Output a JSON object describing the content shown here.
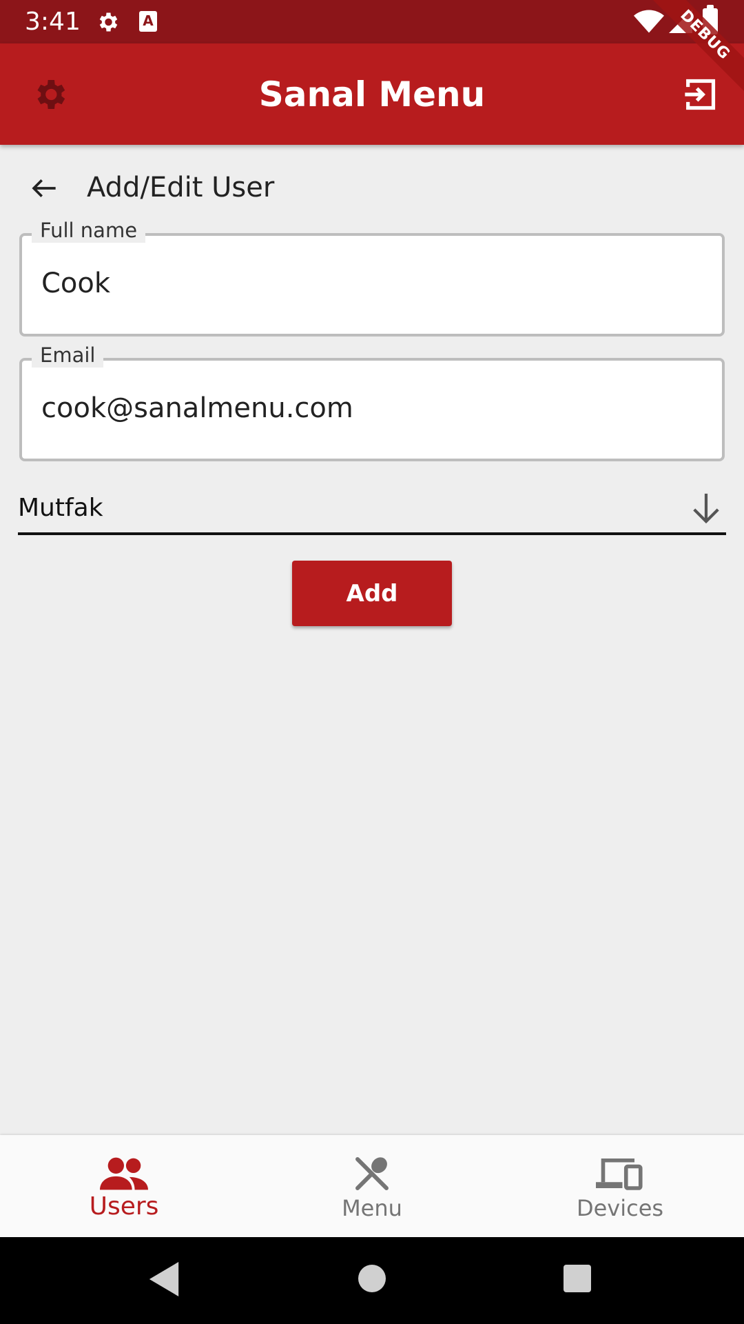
{
  "status_bar": {
    "time": "3:41",
    "icons": [
      "gear-icon",
      "a-badge-icon",
      "wifi-icon",
      "signal-icon",
      "battery-icon"
    ]
  },
  "debug_banner": "DEBUG",
  "app_bar": {
    "title": "Sanal Menu",
    "left_icon": "gear-icon",
    "right_icon": "logout-icon"
  },
  "page": {
    "title": "Add/Edit User"
  },
  "form": {
    "full_name": {
      "label": "Full name",
      "value": "Cook"
    },
    "email": {
      "label": "Email",
      "value": "cook@sanalmenu.com"
    },
    "role": {
      "selected": "Mutfak"
    },
    "add_label": "Add"
  },
  "bottom_nav": {
    "items": [
      {
        "label": "Users",
        "icon": "users-icon",
        "active": true
      },
      {
        "label": "Menu",
        "icon": "utensils-icon",
        "active": false
      },
      {
        "label": "Devices",
        "icon": "devices-icon",
        "active": false
      }
    ]
  },
  "colors": {
    "primary": "#b71c1e",
    "status_bar": "#8c1519",
    "background": "#eeeeee",
    "inactive": "#757575"
  }
}
